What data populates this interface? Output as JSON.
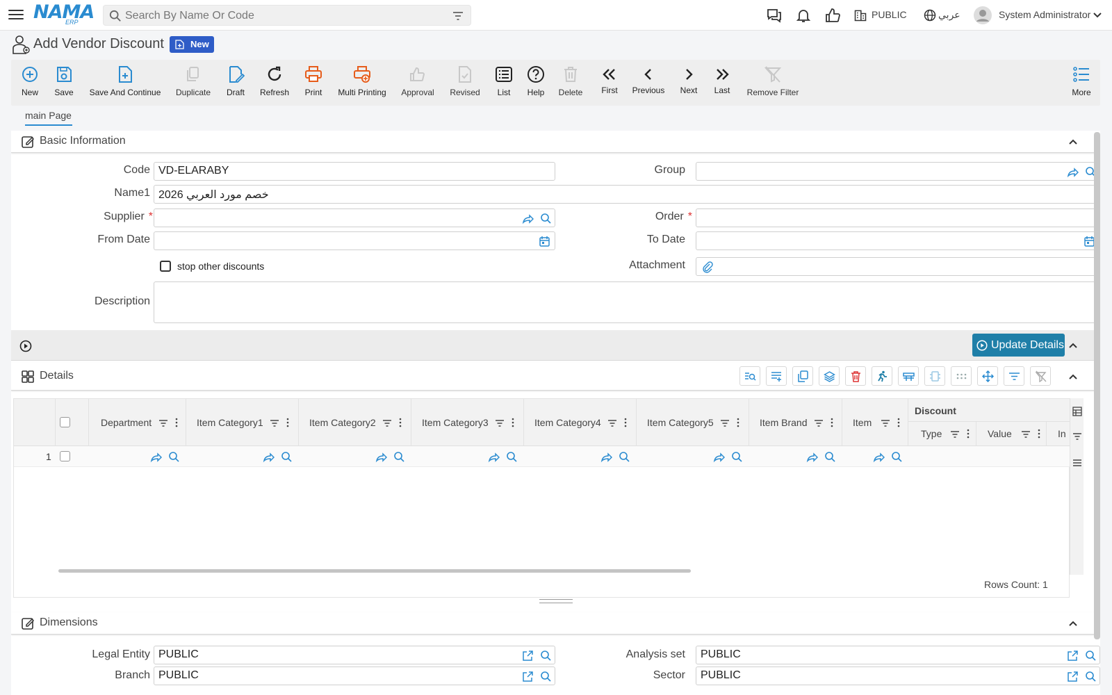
{
  "app": {
    "logo_main": "NAMA",
    "logo_sub": "ERP"
  },
  "search": {
    "placeholder": "Search By Name Or Code"
  },
  "topbar": {
    "entity": "PUBLIC",
    "language": "عربي",
    "user": "System Administrator"
  },
  "page": {
    "title": "Add Vendor Discount",
    "badge": "New"
  },
  "toolbar": {
    "new": "New",
    "save": "Save",
    "save_continue": "Save And Continue",
    "duplicate": "Duplicate",
    "draft": "Draft",
    "refresh": "Refresh",
    "print": "Print",
    "multi_printing": "Multi Printing",
    "approval": "Approval",
    "revised": "Revised",
    "list": "List",
    "help": "Help",
    "delete": "Delete",
    "first": "First",
    "previous": "Previous",
    "next": "Next",
    "last": "Last",
    "remove_filter": "Remove Filter",
    "more": "More"
  },
  "tabs": {
    "main": "main Page"
  },
  "basic": {
    "title": "Basic Information",
    "code_label": "Code",
    "code_value": "VD-ELARABY",
    "group_label": "Group",
    "group_value": "",
    "name1_label": "Name1",
    "name1_value": "خصم مورد العربي 2026",
    "supplier_label": "Supplier",
    "supplier_value": "",
    "order_label": "Order",
    "order_value": "",
    "from_date_label": "From Date",
    "from_date_value": "",
    "to_date_label": "To Date",
    "to_date_value": "",
    "stop_label": "stop other discounts",
    "attachment_label": "Attachment",
    "description_label": "Description",
    "description_value": "",
    "required_mark": "*"
  },
  "actions": {
    "update_details": "Update Details"
  },
  "details": {
    "title": "Details",
    "columns": [
      "Department",
      "Item Category1",
      "Item Category2",
      "Item Category3",
      "Item Category4",
      "Item Category5",
      "Item Brand",
      "Item"
    ],
    "discount_group": "Discount",
    "discount_columns": [
      "Type",
      "Value",
      "In"
    ],
    "rows": [
      {
        "num": "1"
      }
    ],
    "rows_count": "Rows Count: 1"
  },
  "dimensions": {
    "title": "Dimensions",
    "legal_entity_label": "Legal Entity",
    "legal_entity_value": "PUBLIC",
    "analysis_set_label": "Analysis set",
    "analysis_set_value": "PUBLIC",
    "branch_label": "Branch",
    "branch_value": "PUBLIC",
    "sector_label": "Sector",
    "sector_value": "PUBLIC"
  },
  "colors": {
    "accent": "#2a8bd0",
    "badge": "#2e5cc7",
    "update_button": "#1f7fa8",
    "print": "#e65c1a",
    "required": "#dd3333"
  }
}
